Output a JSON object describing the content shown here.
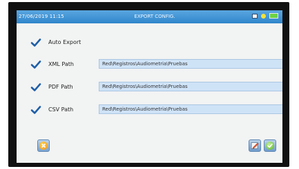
{
  "statusbar": {
    "datetime": "27/06/2019  11:15",
    "title": "EXPORT CONFIG.",
    "icons": [
      "storage-icon",
      "status-dot-icon",
      "battery-icon"
    ]
  },
  "auto_export": {
    "label": "Auto Export",
    "checked": true
  },
  "paths": [
    {
      "label": "XML Path",
      "value": "Red\\Registros\\Audiometria\\Pruebas",
      "checked": true
    },
    {
      "label": "PDF Path",
      "value": "Red\\Registros\\Audiometria\\Pruebas",
      "checked": true
    },
    {
      "label": "CSV Path",
      "value": "Red\\Registros\\Audiometria\\Pruebas",
      "checked": true
    }
  ],
  "buttons": {
    "cancel_icon": "cancel-icon",
    "edit_icon": "edit-icon",
    "confirm_icon": "confirm-icon"
  },
  "colors": {
    "statusbar": "#2f86cb",
    "field_bg": "#cfe3f7",
    "checkmark": "#1f5fa8",
    "battery": "#6dd244"
  }
}
